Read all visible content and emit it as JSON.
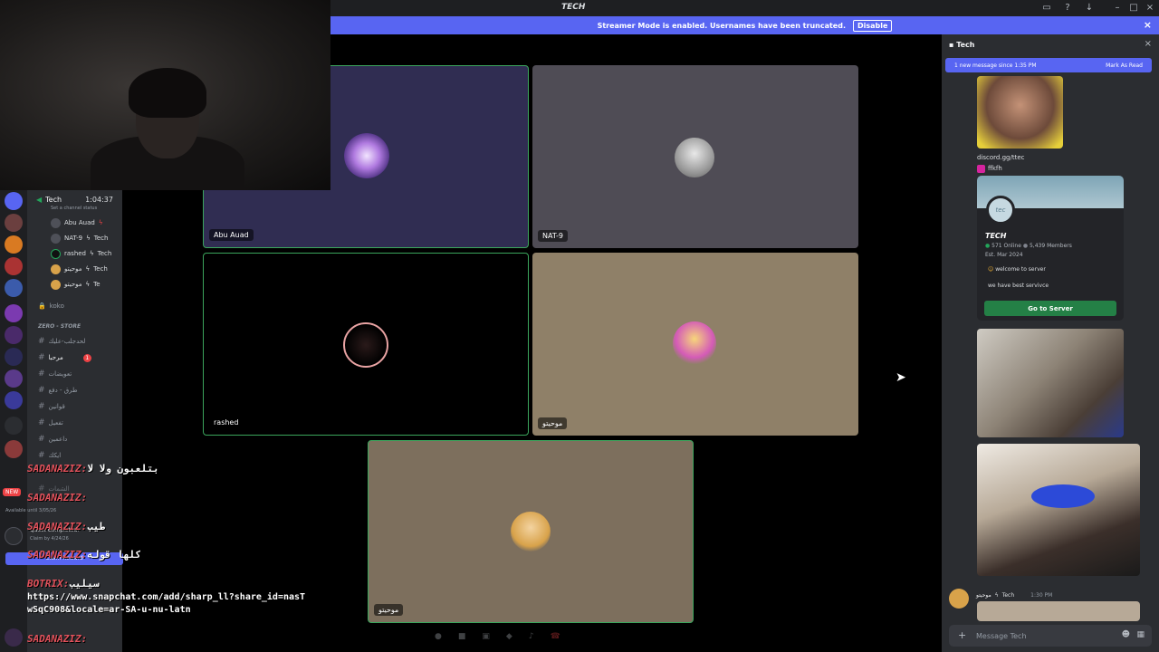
{
  "app": {
    "title": "TECH"
  },
  "banner": {
    "text": "Streamer Mode is enabled. Usernames have been truncated.",
    "button": "Disable"
  },
  "tiles": [
    {
      "name": "Abu Auad"
    },
    {
      "name": "NAT-9"
    },
    {
      "name": "rashed"
    },
    {
      "name": "موحيتو"
    },
    {
      "name": "موحيتو"
    }
  ],
  "channels": {
    "voice": {
      "name": "Tech",
      "timer": "1:04:37",
      "status": "Set a channel status"
    },
    "voice_users": [
      {
        "name": "Abu Auad",
        "tag": ""
      },
      {
        "name": "NAT-9",
        "tag": "Tech"
      },
      {
        "name": "rashed",
        "tag": "Tech"
      },
      {
        "name": "موحيتو",
        "tag": "Tech"
      },
      {
        "name": "موحيتو",
        "tag": "Te"
      }
    ],
    "locked": "koko",
    "category": "ZERO - STORE",
    "text_channels": [
      "لحدجلب-عليك",
      "مرحبا",
      "تعويضات",
      "طرق - دفع",
      "قوانين",
      "تفعيل",
      "داعمين",
      "ايكك",
      "الشمات"
    ],
    "available_until": "Available until 3/05/26",
    "quest_title": "Quest Completed!",
    "quest_claim": "Claim by 4/24/26",
    "claim_button": "Claim Reward",
    "new_badge": "NEW"
  },
  "overlay": [
    {
      "name": "SADANAZIZ:",
      "msg": "بتلعبون ولا لا"
    },
    {
      "name": "SADANAZIZ:",
      "msg": ""
    },
    {
      "name": "SADANAZIZ:",
      "msg": "طيب"
    },
    {
      "name": "SADANAZIZ:",
      "msg": "كلها قوله"
    },
    {
      "name": "BOTRIX:",
      "msg": "سيليب"
    },
    {
      "name": "SADANAZIZ:",
      "msg": ""
    }
  ],
  "overlay_link": "https://www.snapchat.com/add/sharp_ll?share_id=nasTwSqC908&locale=ar-SA-u-nu-latn",
  "right_panel": {
    "title": "Tech",
    "new_messages": "1 new message since 1:35 PM",
    "mark_read": "Mark As Read",
    "link_text": "discord.gg/ttec",
    "insta": "ffkfh",
    "server_card": {
      "icon_text": "tec",
      "name": "TECH",
      "online": "571 Online",
      "members": "5,439 Members",
      "est": "Est. Mar 2024",
      "line1": "welcome to server",
      "line2": "we have best servivce",
      "button": "Go to Server"
    },
    "last_author": "موحيتو",
    "last_tag": "Tech",
    "last_time": "1:30 PM",
    "message_placeholder": "Message Tech"
  }
}
